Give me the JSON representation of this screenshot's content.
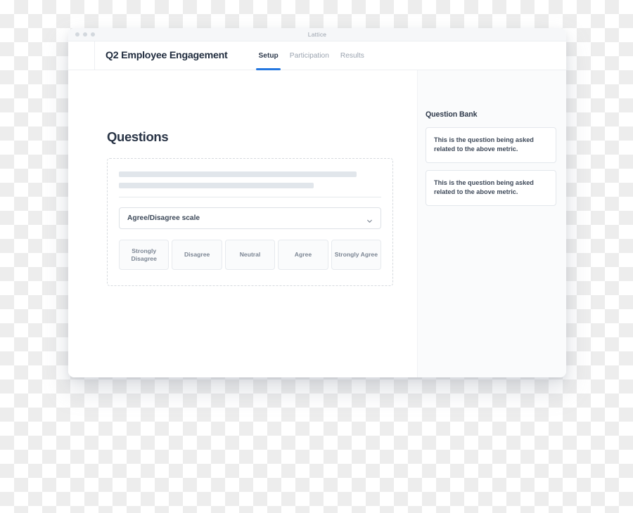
{
  "window": {
    "title": "Lattice",
    "traffic_lights": [
      "close",
      "minimize",
      "maximize"
    ]
  },
  "header": {
    "app_title": "Q2 Employee Engagement",
    "tabs": [
      {
        "label": "Setup",
        "active": true
      },
      {
        "label": "Participation",
        "active": false
      },
      {
        "label": "Results",
        "active": false
      }
    ]
  },
  "main": {
    "page_title": "Questions",
    "question_card": {
      "skeleton_lines": 2,
      "question_type_select": {
        "value": "Agree/Disagree scale",
        "icon": "chevron-down-icon"
      },
      "scale_options": [
        "Strongly Disagree",
        "Disagree",
        "Neutral",
        "Agree",
        "Strongly Agree"
      ]
    }
  },
  "sidebar": {
    "title": "Question Bank",
    "items": [
      "This is the question being asked related to the above metric.",
      "This is the question being asked related to the above metric."
    ]
  },
  "colors": {
    "accent": "#2477e0",
    "title_text": "#1f2b3d",
    "muted_text": "#9aa3af",
    "skeleton": "#e1e6eb",
    "sidebar_bg": "#fafbfc",
    "dashed_border": "#d6dade"
  }
}
